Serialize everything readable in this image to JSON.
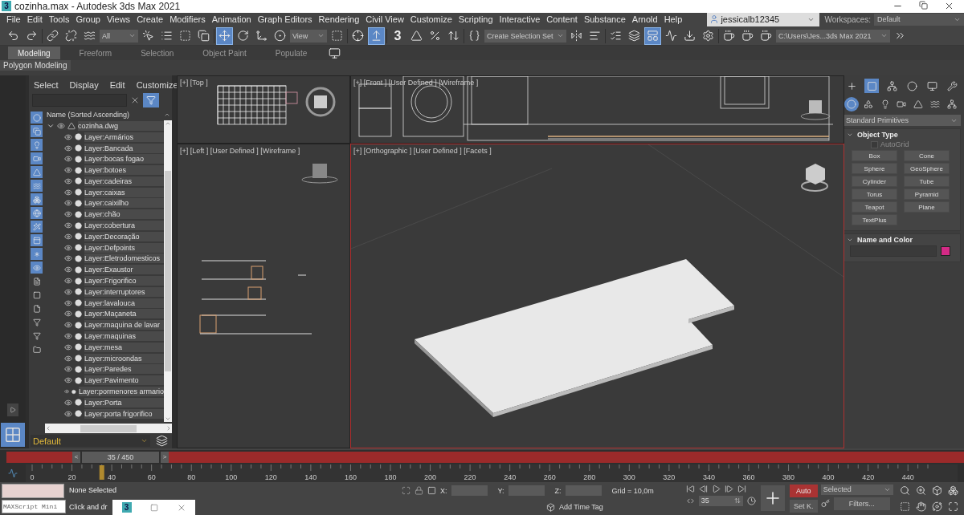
{
  "window": {
    "logo_text": "3",
    "title": "cozinha.max - Autodesk 3ds Max 2021"
  },
  "menu": [
    "File",
    "Edit",
    "Tools",
    "Group",
    "Views",
    "Create",
    "Modifiers",
    "Animation",
    "Graph Editors",
    "Rendering",
    "Civil View",
    "Customize",
    "Scripting",
    "Interactive",
    "Content",
    "Substance",
    "Arnold",
    "Help"
  ],
  "account": {
    "user": "jessicalb12345",
    "workspaces_label": "Workspaces:",
    "workspace": "Default"
  },
  "toolbar": {
    "selection_filter": "All",
    "reference_coord": "View",
    "snap_label": "3",
    "selection_set": "Create Selection Set",
    "project_path": "C:\\Users\\Jes...3ds Max 2021",
    "select_and_move_on": true,
    "select_and_place_on": true,
    "scene_explorer_on": true
  },
  "ribbon": {
    "tabs": [
      {
        "label": "Modeling",
        "selected": true
      },
      {
        "label": "Freeform",
        "selected": false
      },
      {
        "label": "Selection",
        "selected": false
      },
      {
        "label": "Object Paint",
        "selected": false
      },
      {
        "label": "Populate",
        "selected": false
      }
    ],
    "panel": "Polygon Modeling"
  },
  "scene_explorer": {
    "menu": [
      "Select",
      "Display",
      "Edit",
      "Customize"
    ],
    "filter_toggles": [
      {
        "on": true
      },
      {
        "on": true
      },
      {
        "on": true
      },
      {
        "on": true
      },
      {
        "on": true
      },
      {
        "on": true
      },
      {
        "on": true
      },
      {
        "on": true
      },
      {
        "on": true
      },
      {
        "on": true
      },
      {
        "on": true
      },
      {
        "on": true
      },
      {
        "on": false
      },
      {
        "on": false
      },
      {
        "on": false
      },
      {
        "on": false
      },
      {
        "on": false
      },
      {
        "on": false
      }
    ],
    "column": "Name (Sorted Ascending)",
    "root": {
      "name": "cozinha.dwg",
      "expanded": true,
      "children": [
        {
          "name": "Layer:Armários"
        },
        {
          "name": "Layer:Bancada"
        },
        {
          "name": "Layer:bocas fogao"
        },
        {
          "name": "Layer:botoes"
        },
        {
          "name": "Layer:cadeiras"
        },
        {
          "name": "Layer:caixas"
        },
        {
          "name": "Layer:caixilho"
        },
        {
          "name": "Layer:chão"
        },
        {
          "name": "Layer:cobertura"
        },
        {
          "name": "Layer:Decoração"
        },
        {
          "name": "Layer:Defpoints"
        },
        {
          "name": "Layer:Eletrodomesticos"
        },
        {
          "name": "Layer:Exaustor"
        },
        {
          "name": "Layer:Frigorifico"
        },
        {
          "name": "Layer:interruptores"
        },
        {
          "name": "Layer:lavalouca"
        },
        {
          "name": "Layer:Maçaneta"
        },
        {
          "name": "Layer:maquina de lavar"
        },
        {
          "name": "Layer:maquinas"
        },
        {
          "name": "Layer:mesa"
        },
        {
          "name": "Layer:microondas"
        },
        {
          "name": "Layer:Paredes"
        },
        {
          "name": "Layer:Pavimento"
        },
        {
          "name": "Layer:pormenores armario"
        },
        {
          "name": "Layer:Porta"
        },
        {
          "name": "Layer:porta frigorifico"
        }
      ]
    },
    "layer": "Default"
  },
  "viewports": [
    {
      "kind": "top",
      "label": "[+] [Top ]",
      "active": false
    },
    {
      "kind": "front",
      "label": "[+] [Front ] [User Defined ] [Wireframe ]",
      "active": false
    },
    {
      "kind": "left",
      "label": "[+] [Left ] [User Defined ] [Wireframe ]",
      "active": false
    },
    {
      "kind": "ortho",
      "label": "[+] [Orthographic ] [User Defined ] [Facets ]",
      "active": true
    }
  ],
  "command_panel": {
    "tabs": [
      {
        "selected": false
      },
      {
        "selected": true
      },
      {
        "selected": false
      },
      {
        "selected": false
      },
      {
        "selected": false
      },
      {
        "selected": false
      }
    ],
    "object_categories": [
      {
        "selected": true
      },
      {
        "selected": false
      },
      {
        "selected": false
      },
      {
        "selected": false
      },
      {
        "selected": false
      },
      {
        "selected": false
      },
      {
        "selected": false
      }
    ],
    "category": "Standard Primitives",
    "object_type": {
      "title": "Object Type",
      "autogrid": {
        "label": "AutoGrid",
        "checked": false,
        "disabled": true
      },
      "buttons": [
        "Box",
        "Cone",
        "Sphere",
        "GeoSphere",
        "Cylinder",
        "Tube",
        "Torus",
        "Pyramid",
        "Teapot",
        "Plane",
        "TextPlus"
      ]
    },
    "name_and_color": {
      "title": "Name and Color",
      "color": "#d42a86"
    }
  },
  "timeline": {
    "prev": "<",
    "frame": "35 / 450",
    "next": ">",
    "level": 0.0778,
    "ruler_labels": [
      "0",
      "20",
      "40",
      "60",
      "80",
      "100",
      "120",
      "140",
      "160",
      "180",
      "200",
      "220",
      "240",
      "260",
      "280",
      "300",
      "320",
      "340",
      "360",
      "380",
      "400",
      "420",
      "440"
    ]
  },
  "status": {
    "script_label": "MAXScript Mini",
    "selection": "None Selected",
    "prompt": "Click and dr",
    "x_label": "X:",
    "y_label": "Y:",
    "z_label": "Z:",
    "grid": "Grid = 10,0m",
    "time_tag": "Add Time Tag",
    "current_frame": "35",
    "auto_key": {
      "label": "Auto",
      "on": true
    },
    "key_filter": "Selected",
    "set_key": "Set K.",
    "filters": "Filters..."
  },
  "mini_window": {
    "logo_text": "3"
  }
}
